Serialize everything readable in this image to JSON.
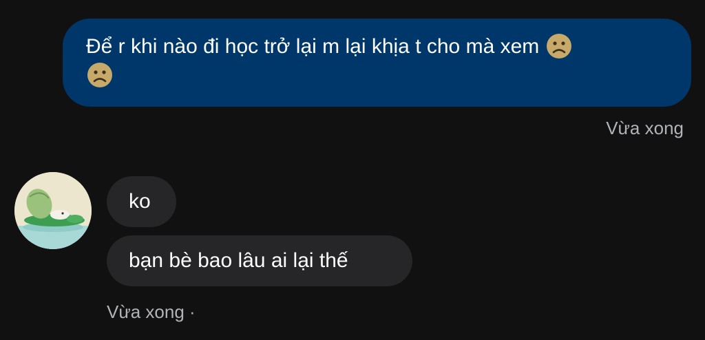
{
  "conversation": {
    "outgoing": {
      "text": "Để r khi nào đi học trở lại m lại khịa t cho mà xem",
      "emojis": [
        "frowning-face-emoji",
        "frowning-face-emoji"
      ],
      "timestamp": "Vừa xong"
    },
    "incoming": {
      "avatar": "sender-avatar",
      "messages": [
        "ko",
        "bạn bè bao lâu ai lại thế"
      ],
      "timestamp": "Vừa xong ·"
    }
  },
  "colors": {
    "background": "#111112",
    "outgoing_bubble": "#00376b",
    "incoming_bubble": "#262628",
    "timestamp_text": "#b0b3b8",
    "emoji_face": "#c7a96a"
  }
}
